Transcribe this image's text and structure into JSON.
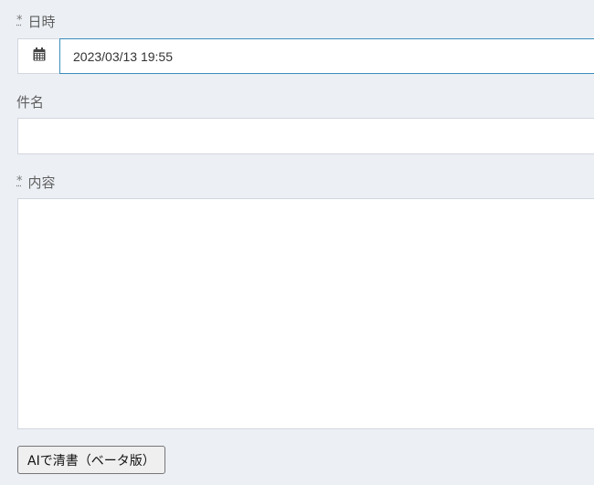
{
  "fields": {
    "datetime": {
      "required_mark": "*",
      "label": "日時",
      "value": "2023/03/13 19:55",
      "icon": "calendar-icon"
    },
    "subject": {
      "label": "件名",
      "value": ""
    },
    "content": {
      "required_mark": "*",
      "label": "内容",
      "value": ""
    }
  },
  "buttons": {
    "ai_cleanup_label": "AIで清書（ベータ版）"
  },
  "colors": {
    "background": "#ecf0f5",
    "focus_border": "#3c8dbc",
    "input_border": "#d2d6de"
  }
}
